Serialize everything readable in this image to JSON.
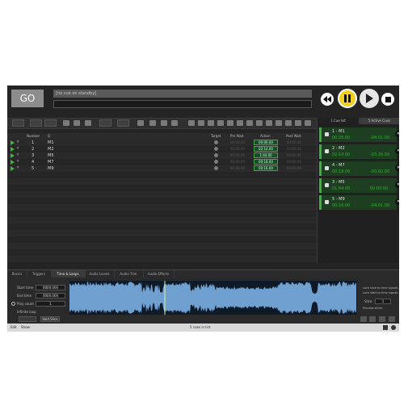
{
  "go": {
    "label": "GO"
  },
  "cue_title_placeholder": "[no cue on standby]",
  "toolbar": {
    "select_label": "",
    "timeline_label": ""
  },
  "headers": {
    "number": "Number",
    "q": "Q",
    "target": "Target",
    "pre_wait": "Pre Wait",
    "action": "Action",
    "post_wait": "Post Wait"
  },
  "cues": [
    {
      "number": "1",
      "name": "M1",
      "action": "00:06.00"
    },
    {
      "number": "2",
      "name": "M2",
      "action": "02:14.00"
    },
    {
      "number": "3",
      "name": "M5",
      "action": "1:44.00"
    },
    {
      "number": "4",
      "name": "M7",
      "action": "00:18.00"
    },
    {
      "number": "5",
      "name": "M9",
      "action": "00:16.00"
    }
  ],
  "pre_wait_placeholder": "00:00.00",
  "side_tabs": [
    "1 Cue list",
    "5 Active Cues"
  ],
  "active_cues": [
    {
      "name": "1 - M1",
      "elapsed": "00:25.00",
      "remaining": "-04:01.00"
    },
    {
      "name": "2 - M2",
      "elapsed": "02:14.00",
      "remaining": "-03:20.00"
    },
    {
      "name": "4 - M7",
      "elapsed": "00:18.00",
      "remaining": "-00:02.00"
    },
    {
      "name": "3 - M5",
      "elapsed": "01:44.00",
      "remaining": "00:00.00"
    },
    {
      "name": "5 - M9",
      "elapsed": "00:16.00",
      "remaining": "-04:01.00"
    }
  ],
  "inspector_tabs": [
    "Basics",
    "Triggers",
    "Time & Loops",
    "Audio Levels",
    "Audio Trim",
    "Audio Effects"
  ],
  "inspector": {
    "start_time_label": "Start time",
    "start_time": "0000.000",
    "end_time_label": "End time",
    "end_time": "0000.000",
    "play_count_label": "Play count",
    "play_count": "1",
    "infinite_loop_label": "Infinite loop",
    "slice_label": "",
    "loop_slice_label": "",
    "void_slice_label": "Void Slice",
    "option1": "Lock slice to time signature",
    "option2": "Lock start to time signature",
    "slice_count_label": "Slice",
    "slice_count": "1",
    "preview_label": "Preview slices"
  },
  "status": {
    "left1": "Edit",
    "left2": "Show",
    "center": "5 cues in list"
  },
  "colors": {
    "go_bg": "#8c8c8c",
    "pause": "#f0d020",
    "active_green": "#2fb02f",
    "wave": "#6fa0d0"
  }
}
